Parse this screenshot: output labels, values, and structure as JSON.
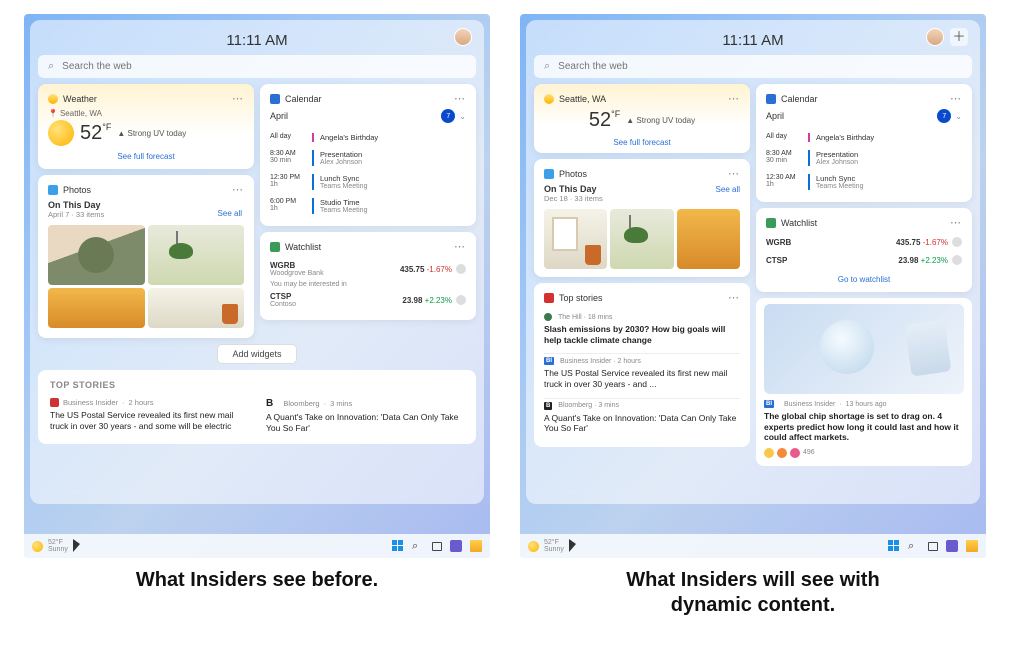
{
  "captions": {
    "left": "What Insiders see before.",
    "right": "What Insiders will see with\ndynamic content."
  },
  "shared": {
    "time": "11:11 AM",
    "search_placeholder": "Search the web",
    "weather": {
      "title": "Weather",
      "location": "Seattle, WA",
      "temp": "52",
      "scale": "°F",
      "note": "Strong UV today",
      "link": "See full forecast"
    },
    "calendar": {
      "title": "Calendar",
      "month": "April",
      "day": "7"
    },
    "photos": {
      "title": "Photos",
      "heading": "On This Day",
      "seeall": "See all"
    },
    "watchlist": {
      "title": "Watchlist",
      "interest": "You may be interested in",
      "go": "Go to watchlist",
      "stocks": [
        {
          "sym": "WGRB",
          "co": "Woodgrove Bank",
          "price": "435.75",
          "chg": "-1.67%",
          "dir": "down"
        },
        {
          "sym": "CTSP",
          "co": "Contoso",
          "price": "23.98",
          "chg": "+2.23%",
          "dir": "up"
        }
      ]
    },
    "add_widgets": "Add widgets",
    "topstories_label": "TOP STORIES",
    "topstories_label2": "Top stories",
    "taskbar": {
      "temp": "52°F",
      "cond": "Sunny"
    }
  },
  "left": {
    "photos_meta": "April 7 · 33 items",
    "events": [
      {
        "t1": "All day",
        "t2": "",
        "title": "Angela's Birthday",
        "sub": "",
        "cls": "pink"
      },
      {
        "t1": "8:30 AM",
        "t2": "30 min",
        "title": "Presentation",
        "sub": "Alex Johnson",
        "cls": "blue"
      },
      {
        "t1": "12:30 PM",
        "t2": "1h",
        "title": "Lunch Sync",
        "sub": "Teams Meeting",
        "cls": "blue"
      },
      {
        "t1": "6:00 PM",
        "t2": "1h",
        "title": "Studio Time",
        "sub": "Teams Meeting",
        "cls": "blue"
      }
    ],
    "stories": [
      {
        "src": "Business Insider",
        "age": "2 hours",
        "head": "The US Postal Service revealed its first new mail truck in over 30 years - and some will be electric"
      },
      {
        "src": "Bloomberg",
        "age": "3 mins",
        "head": "A Quant's Take on Innovation: 'Data Can Only Take You So Far'",
        "bold": "B"
      }
    ]
  },
  "right": {
    "photos_meta": "Dec 18 · 33 items",
    "events": [
      {
        "t1": "All day",
        "t2": "",
        "title": "Angela's Birthday",
        "sub": "",
        "cls": "pink"
      },
      {
        "t1": "8:30 AM",
        "t2": "30 min",
        "title": "Presentation",
        "sub": "Alex Johnson",
        "cls": "blue"
      },
      {
        "t1": "12:30 AM",
        "t2": "1h",
        "title": "Lunch Sync",
        "sub": "Teams Meeting",
        "cls": "blue"
      }
    ],
    "news_left": [
      {
        "src": "The Hill",
        "age": "18 mins",
        "head": "Slash emissions by 2030? How big goals will help tackle climate change"
      },
      {
        "src": "Business Insider",
        "age": "2 hours",
        "head": "The US Postal Service revealed its first new mail truck in over 30 years - and ...",
        "bold": "BI"
      },
      {
        "src": "Bloomberg",
        "age": "3 mins",
        "head": "A Quant's Take on Innovation: 'Data Can Only Take You So Far'",
        "bold": "B"
      }
    ],
    "news_right": {
      "src": "Business Insider",
      "age": "13 hours ago",
      "bold": "BI",
      "head": "The global chip shortage is set to drag on. 4 experts predict how long it could last and how it could affect markets.",
      "reactions": "496"
    }
  }
}
